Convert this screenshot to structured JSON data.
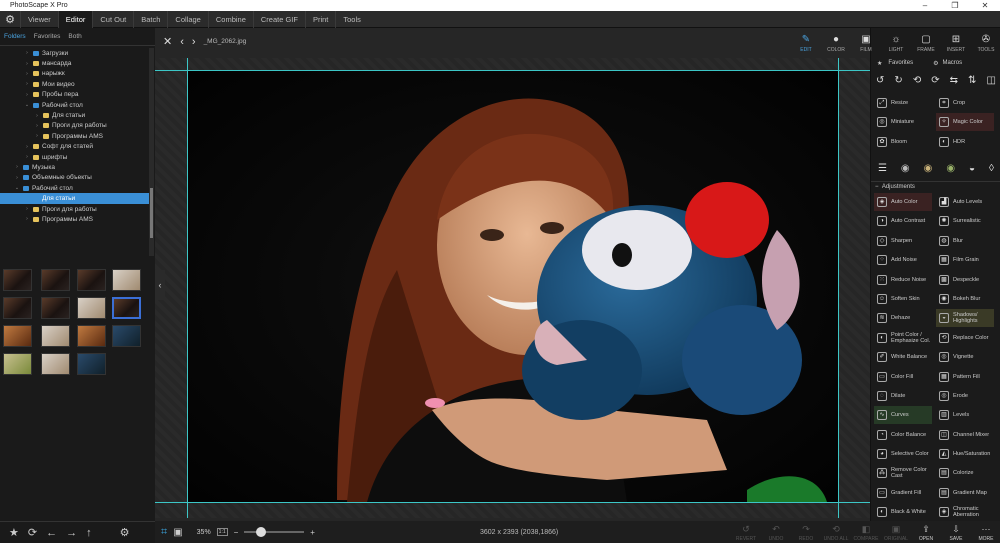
{
  "window": {
    "title": "PhotoScape X Pro",
    "controls": [
      "–",
      "❐",
      "✕"
    ]
  },
  "menu": {
    "items": [
      "Viewer",
      "Editor",
      "Cut Out",
      "Batch",
      "Collage",
      "Combine",
      "Create GIF",
      "Print",
      "Tools"
    ],
    "active": "Editor"
  },
  "folders": {
    "tabs": [
      "Folders",
      "Favorites",
      "Both"
    ],
    "tree": [
      {
        "label": "Загрузки",
        "indent": 0,
        "color": "#3a8fd6",
        "arrow": "›"
      },
      {
        "label": "мансарда",
        "indent": 0,
        "color": "#e6c35c",
        "arrow": "›"
      },
      {
        "label": "нарыжк",
        "indent": 0,
        "color": "#e6c35c",
        "arrow": "›"
      },
      {
        "label": "Мои видео",
        "indent": 0,
        "color": "#e6c35c",
        "arrow": "›"
      },
      {
        "label": "Пробы пера",
        "indent": 0,
        "color": "#e6c35c",
        "arrow": "›"
      },
      {
        "label": "Рабочий стол",
        "indent": 0,
        "color": "#3a8fd6",
        "arrow": "⌄"
      },
      {
        "label": "Для статьи",
        "indent": 1,
        "color": "#e6c35c",
        "arrow": "›"
      },
      {
        "label": "Проги для работы",
        "indent": 1,
        "color": "#e6c35c",
        "arrow": "›"
      },
      {
        "label": "Программы AMS",
        "indent": 1,
        "color": "#e6c35c",
        "arrow": "›"
      },
      {
        "label": "Софт для статей",
        "indent": 0,
        "color": "#e6c35c",
        "arrow": "›"
      },
      {
        "label": "шрифты",
        "indent": 0,
        "color": "#e6c35c",
        "arrow": "›"
      },
      {
        "label": "Музыка",
        "indent": -1,
        "color": "#3a8fd6",
        "arrow": "›"
      },
      {
        "label": "Объемные объекты",
        "indent": -1,
        "color": "#3a8fd6",
        "arrow": "›"
      },
      {
        "label": "Рабочий стол",
        "indent": -1,
        "color": "#3a8fd6",
        "arrow": "⌄"
      },
      {
        "label": "Для статьи",
        "indent": 0,
        "color": "#3a8fd6",
        "arrow": "",
        "selected": true
      },
      {
        "label": "Проги для работы",
        "indent": 0,
        "color": "#e6c35c",
        "arrow": "›"
      },
      {
        "label": "Программы AMS",
        "indent": 0,
        "color": "#e6c35c",
        "arrow": "›"
      }
    ]
  },
  "editor": {
    "filename": "_MG_2062.jpg",
    "zoom": "35%",
    "ratio": "1:1",
    "dimensions": "3602 x 2393 (2038,1866)"
  },
  "right_tabs": [
    {
      "label": "EDIT",
      "icon": "✎",
      "on": true
    },
    {
      "label": "COLOR",
      "icon": "●"
    },
    {
      "label": "FILM",
      "icon": "▣"
    },
    {
      "label": "LIGHT",
      "icon": "☼"
    },
    {
      "label": "FRAME",
      "icon": "▢"
    },
    {
      "label": "INSERT",
      "icon": "⊞"
    },
    {
      "label": "TOOLS",
      "icon": "✇"
    }
  ],
  "favorites": {
    "favorites": "Favorites",
    "macros": "Macros"
  },
  "tools_top": [
    {
      "label": "Resize",
      "icon": "⤢"
    },
    {
      "label": "Crop",
      "icon": "⌗"
    },
    {
      "label": "Miniature",
      "icon": "◎"
    },
    {
      "label": "Magic Color",
      "icon": "✧",
      "hl": "red"
    },
    {
      "label": "Bloom",
      "icon": "✿"
    },
    {
      "label": "HDR",
      "icon": "◐"
    }
  ],
  "adjustments_header": "Adjustments",
  "adjustments": [
    {
      "label": "Auto Color",
      "icon": "◈",
      "hl": "red"
    },
    {
      "label": "Auto Levels",
      "icon": "▟"
    },
    {
      "label": "Auto Contrast",
      "icon": "◑"
    },
    {
      "label": "Surrealistic",
      "icon": "✺"
    },
    {
      "label": "Sharpen",
      "icon": "◇"
    },
    {
      "label": "Blur",
      "icon": "◍"
    },
    {
      "label": "Add Noise",
      "icon": "⁘"
    },
    {
      "label": "Film Grain",
      "icon": "▦"
    },
    {
      "label": "Reduce Noise",
      "icon": "⁙"
    },
    {
      "label": "Despeckle",
      "icon": "▩"
    },
    {
      "label": "Soften Skin",
      "icon": "☺"
    },
    {
      "label": "Bokeh Blur",
      "icon": "◉"
    },
    {
      "label": "Dehaze",
      "icon": "≋"
    },
    {
      "label": "Shadows/ Highlights",
      "icon": "◒",
      "hl": "olive"
    },
    {
      "label": "Point Color / Emphasize Col.",
      "icon": "◐"
    },
    {
      "label": "Replace Color",
      "icon": "⟲"
    },
    {
      "label": "White Balance",
      "icon": "✐"
    },
    {
      "label": "Vignette",
      "icon": "◎"
    },
    {
      "label": "Color Fill",
      "icon": "▭"
    },
    {
      "label": "Pattern Fill",
      "icon": "▦"
    },
    {
      "label": "Dilate",
      "icon": "◌"
    },
    {
      "label": "Erode",
      "icon": "◎"
    },
    {
      "label": "Curves",
      "icon": "∿",
      "hl": "green"
    },
    {
      "label": "Levels",
      "icon": "▥"
    },
    {
      "label": "Color Balance",
      "icon": "◔"
    },
    {
      "label": "Channel Mixer",
      "icon": "◫"
    },
    {
      "label": "Selective Color",
      "icon": "◕"
    },
    {
      "label": "Hue/Saturation",
      "icon": "◭"
    },
    {
      "label": "Remove Color Cast",
      "icon": "⁂"
    },
    {
      "label": "Colorize",
      "icon": "▤"
    },
    {
      "label": "Gradient Fill",
      "icon": "▭"
    },
    {
      "label": "Gradient Map",
      "icon": "▤"
    },
    {
      "label": "Black & White",
      "icon": "◐"
    },
    {
      "label": "Chromatic Aberration",
      "icon": "◈"
    }
  ],
  "bottom_actions": [
    {
      "label": "REVERT",
      "icon": "↺"
    },
    {
      "label": "UNDO",
      "icon": "↶"
    },
    {
      "label": "REDO",
      "icon": "↷"
    },
    {
      "label": "UNDO ALL",
      "icon": "⟲"
    },
    {
      "label": "COMPARE",
      "icon": "◧"
    },
    {
      "label": "ORIGINAL",
      "icon": "▣"
    },
    {
      "label": "OPEN",
      "icon": "⇪",
      "act": true
    },
    {
      "label": "SAVE",
      "icon": "⇩",
      "act": true
    },
    {
      "label": "MORE",
      "icon": "⋯",
      "act": true
    }
  ]
}
